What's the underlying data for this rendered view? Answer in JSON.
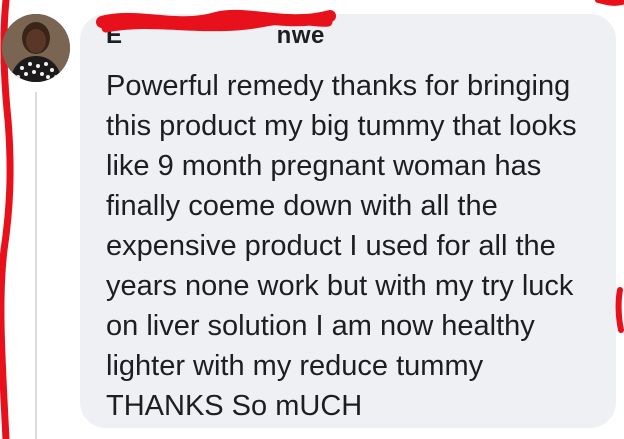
{
  "comment": {
    "author_name": "E       nwe",
    "text": "Powerful remedy thanks for bringing\nthis product my big tummy that looks\nlike 9 month pregnant woman has\nfinally coeme down with all the\nexpensive product I used for all the\nyears none work but with my try luck\non liver solution I am now healthy\nlighter with my reduce tummy\nTHANKS So mUCH"
  },
  "colors": {
    "bubble": "#eef0f3",
    "text": "#1c1e21",
    "marker": "#e8101a"
  }
}
